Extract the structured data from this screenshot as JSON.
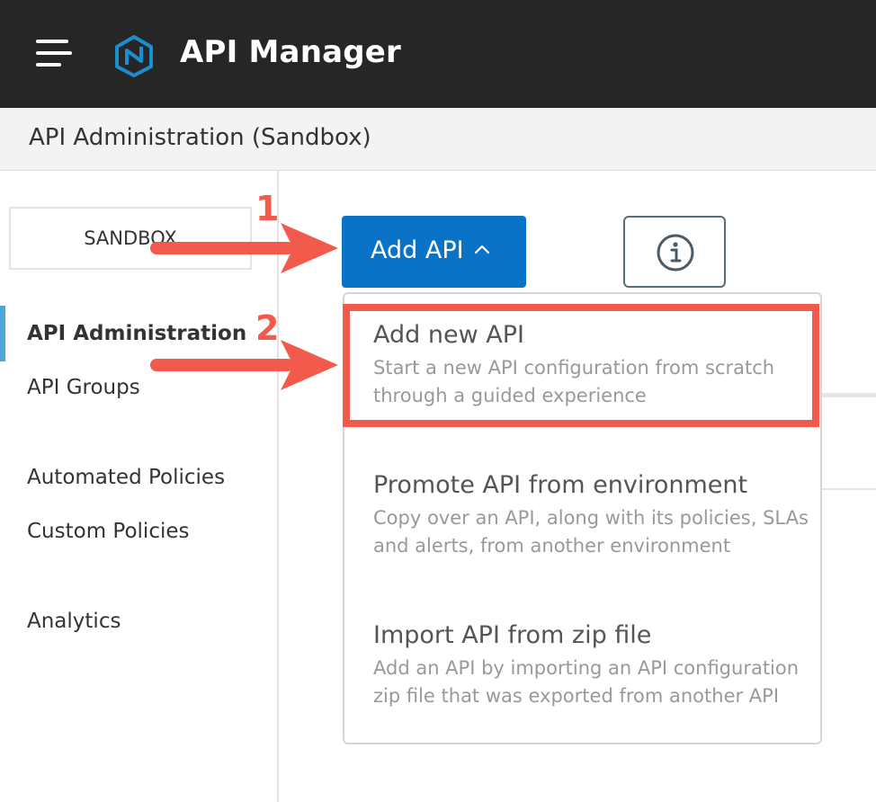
{
  "header": {
    "app_title": "API Manager",
    "menu_icon": "hamburger-menu-icon",
    "logo_icon": "api-manager-logo-icon"
  },
  "subheader": {
    "title": "API Administration (Sandbox)"
  },
  "sidebar": {
    "environment_button": "SANDBOX",
    "items": [
      {
        "label": "API Administration",
        "active": true
      },
      {
        "label": "API Groups",
        "active": false
      },
      {
        "label": "Automated Policies",
        "active": false
      },
      {
        "label": "Custom Policies",
        "active": false
      },
      {
        "label": "Analytics",
        "active": false
      }
    ]
  },
  "toolbar": {
    "add_api_label": "Add API",
    "add_api_icon": "chevron-up-icon",
    "info_icon": "info-icon"
  },
  "dropdown": {
    "items": [
      {
        "title": "Add new API",
        "desc_line1": "Start a new API configuration from scratch",
        "desc_line2": "through a guided experience"
      },
      {
        "title": "Promote API from environment",
        "desc_line1": "Copy over an API, along with its policies, SLAs",
        "desc_line2": "and alerts, from another environment"
      },
      {
        "title": "Import API from zip file",
        "desc_line1": "Add an API by importing an API configuration",
        "desc_line2": "zip file that was exported from another API"
      }
    ]
  },
  "annotations": {
    "step1": "1",
    "step2": "2"
  },
  "colors": {
    "topbar": "#262626",
    "primary_button": "#0a73c8",
    "annotation": "#f25a4c",
    "active_indicator": "#4aa6dd"
  }
}
